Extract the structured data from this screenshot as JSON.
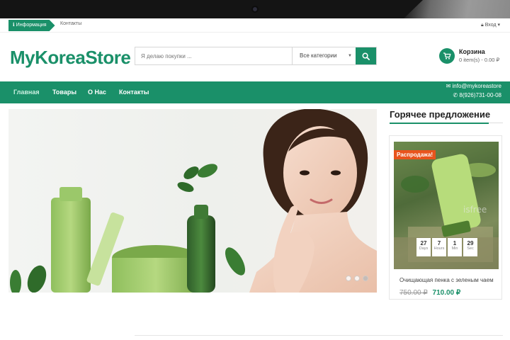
{
  "topbar": {
    "info_label": "Информация",
    "contacts_label": "Контакты",
    "login_label": "Вход"
  },
  "header": {
    "logo": "MyKoreaStore",
    "search_placeholder": "Я делаю покупки ...",
    "category_selected": "Все категории",
    "cart_title": "Корзина",
    "cart_total": "0 item(s) - 0.00 ₽"
  },
  "nav": {
    "items": [
      "Главная",
      "Товары",
      "О Нас",
      "Контакты"
    ],
    "active_index": 0,
    "email": "info@mykoreastore",
    "phone": "8(926)731-00-08"
  },
  "hero": {
    "slides_count": 3,
    "active_slide": 3
  },
  "hot_offer": {
    "title": "Горячее предложение",
    "badge": "Распродажа!",
    "product_name": "Очищающая пенка с зеленым чаем",
    "old_price": "750.00 ₽",
    "new_price": "710.00 ₽",
    "countdown": [
      {
        "value": "27",
        "label": "Days"
      },
      {
        "value": "7",
        "label": "Hours"
      },
      {
        "value": "1",
        "label": "Min"
      },
      {
        "value": "29",
        "label": "Sec"
      }
    ]
  },
  "colors": {
    "brand_green": "#1a9069",
    "sale_orange": "#e8541d"
  }
}
